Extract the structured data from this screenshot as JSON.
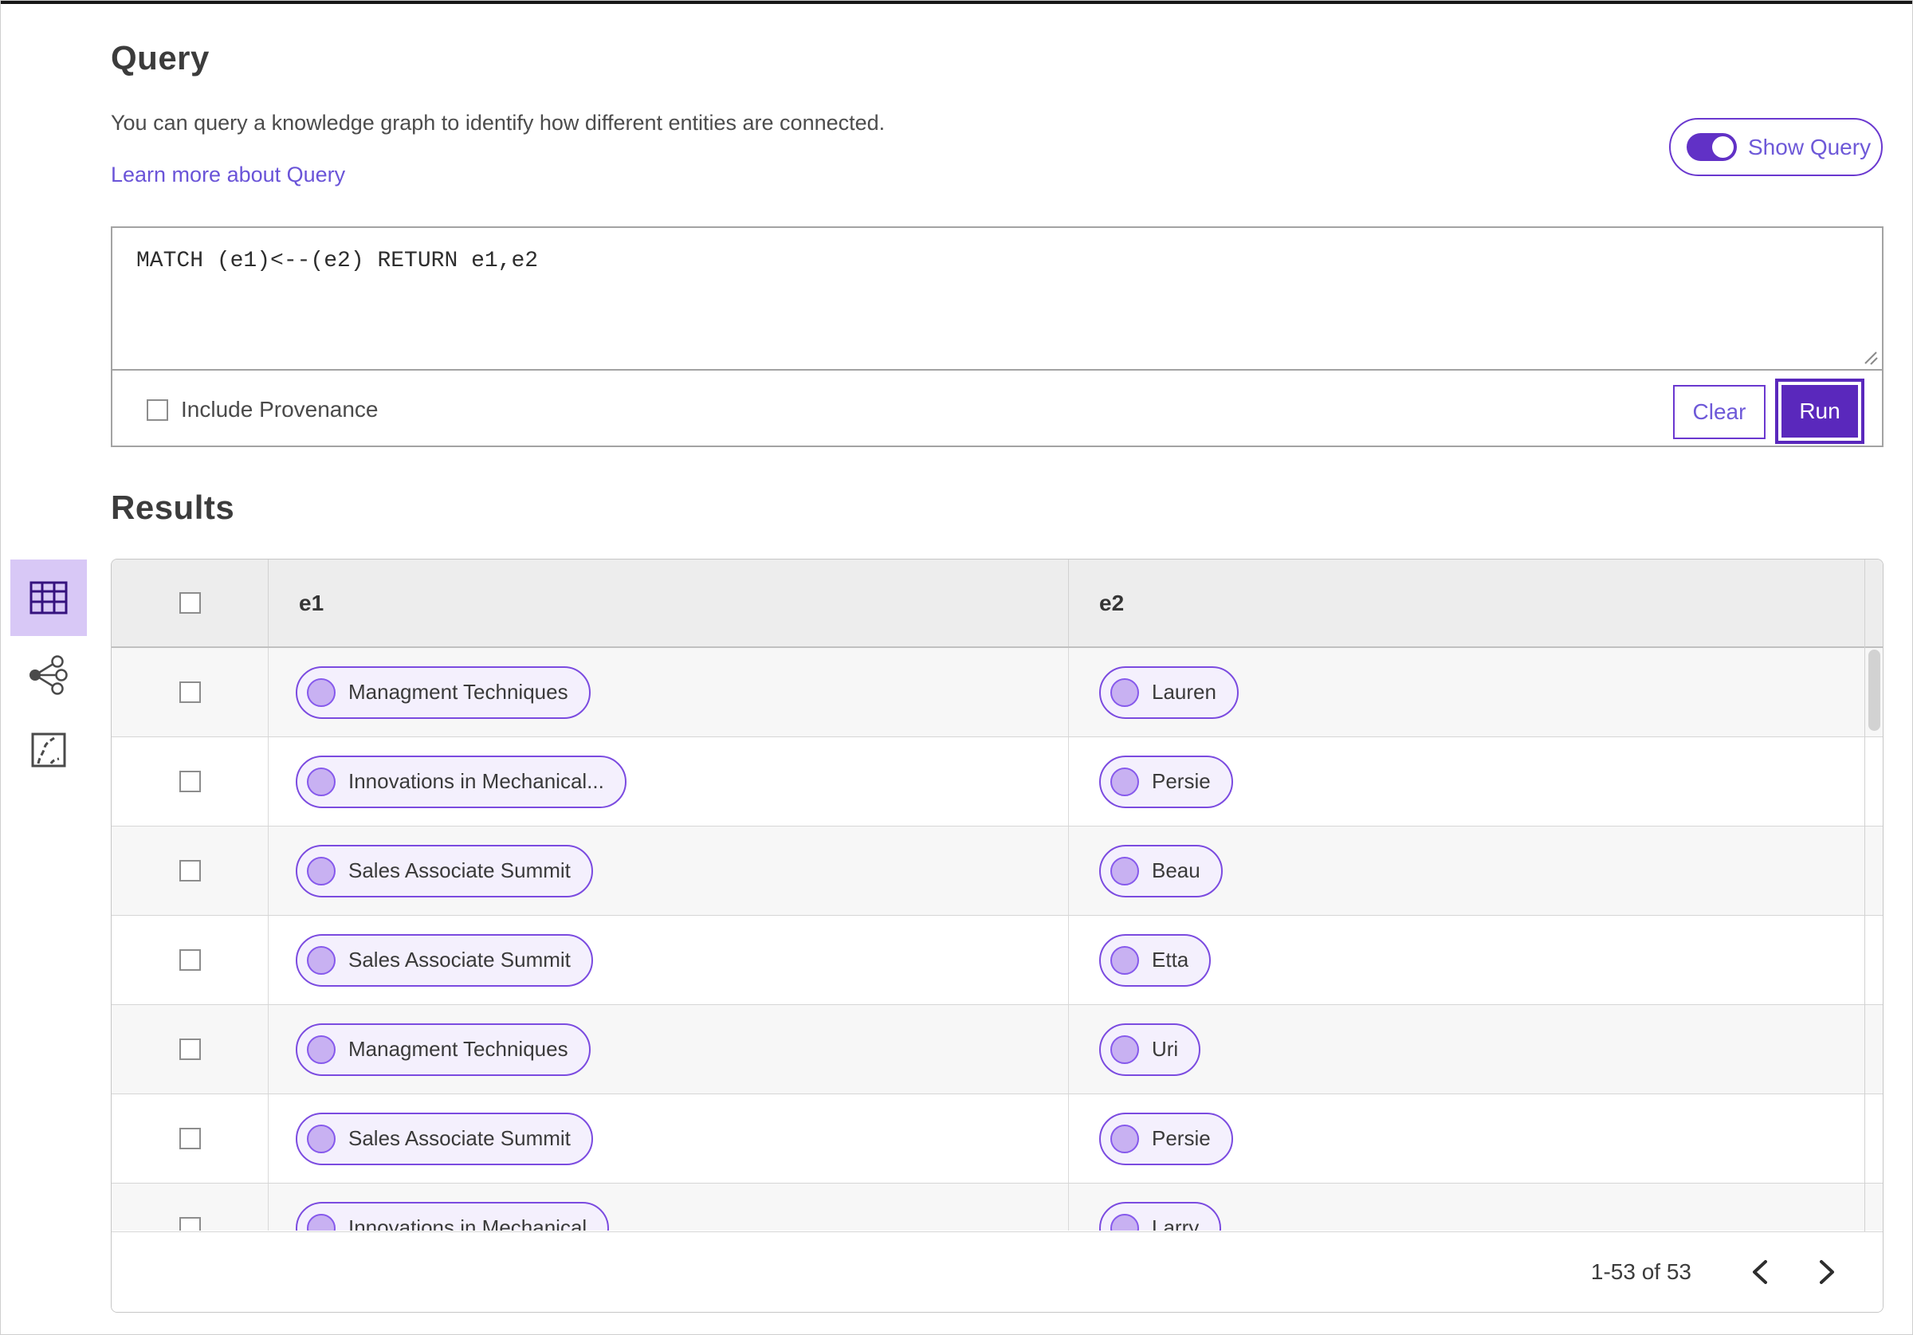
{
  "page": {
    "title": "Query",
    "description": "You can query a knowledge graph to identify how different entities are connected.",
    "learn_more": "Learn more about Query",
    "show_query_label": "Show Query",
    "show_query_state": "on",
    "query_text": "MATCH (e1)<--(e2) RETURN e1,e2",
    "include_provenance_label": "Include Provenance",
    "include_provenance_checked": false,
    "clear_label": "Clear",
    "run_label": "Run",
    "results_title": "Results"
  },
  "view_switcher": {
    "selected": "table-view",
    "items": [
      {
        "name": "table-view",
        "icon": "table-grid-icon"
      },
      {
        "name": "graph-view",
        "icon": "network-nodes-icon"
      },
      {
        "name": "path-view",
        "icon": "route-map-icon"
      }
    ]
  },
  "table": {
    "columns": [
      "e1",
      "e2"
    ],
    "rows": [
      {
        "e1": "Managment Techniques",
        "e2": "Lauren"
      },
      {
        "e1": "Innovations in Mechanical...",
        "e2": "Persie"
      },
      {
        "e1": "Sales Associate Summit",
        "e2": "Beau"
      },
      {
        "e1": "Sales Associate Summit",
        "e2": "Etta"
      },
      {
        "e1": "Managment Techniques",
        "e2": "Uri"
      },
      {
        "e1": "Sales Associate Summit",
        "e2": "Persie"
      },
      {
        "e1": "Innovations in Mechanical",
        "e2": "Larry"
      }
    ],
    "pagination": {
      "range_text": "1-53 of 53",
      "prev_icon": "chevron-left",
      "next_icon": "chevron-right"
    }
  },
  "colors": {
    "accent_purple": "#6131c6",
    "run_button": "#5a28bc",
    "link_purple": "#6e59d8",
    "pill_border": "#7b4be0",
    "pill_bg": "#f4f0fd",
    "pill_dot": "#c8b1f2",
    "selected_rail_bg": "#d8c8f6",
    "header_bg": "#ededed",
    "row_alt_bg": "#f7f7f7"
  }
}
